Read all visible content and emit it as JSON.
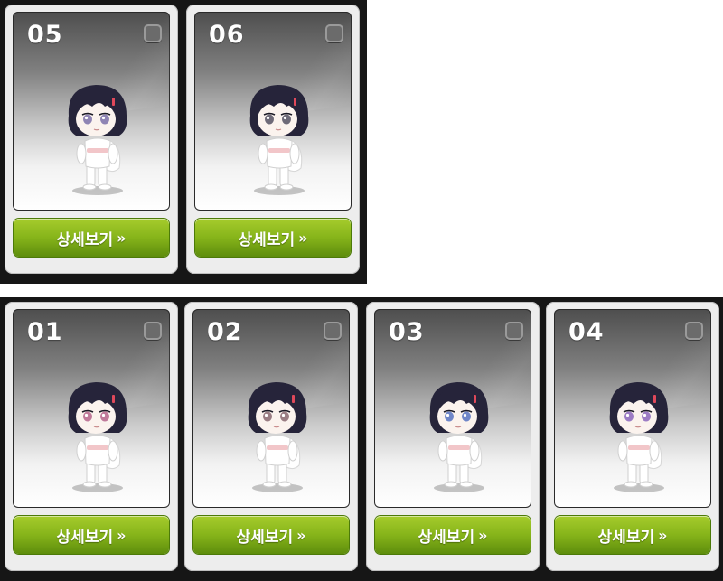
{
  "cards": [
    {
      "number": "05",
      "button_label": "상세보기",
      "button_chevron": "»",
      "eye_color": "#8f84b4"
    },
    {
      "number": "06",
      "button_label": "상세보기",
      "button_chevron": "»",
      "eye_color": "#6e6a78"
    },
    {
      "number": "01",
      "button_label": "상세보기",
      "button_chevron": "»",
      "eye_color": "#c07a9a"
    },
    {
      "number": "02",
      "button_label": "상세보기",
      "button_chevron": "»",
      "eye_color": "#9a7d83"
    },
    {
      "number": "03",
      "button_label": "상세보기",
      "button_chevron": "»",
      "eye_color": "#6f86c8"
    },
    {
      "number": "04",
      "button_label": "상세보기",
      "button_chevron": "»",
      "eye_color": "#9c7cc4"
    }
  ],
  "colors": {
    "button_green": "#86b41a",
    "hair": "#26243a",
    "frame": "#161616"
  },
  "icons": {
    "checkbox": "checkbox-icon",
    "chevron": "double-chevron-right-icon"
  }
}
